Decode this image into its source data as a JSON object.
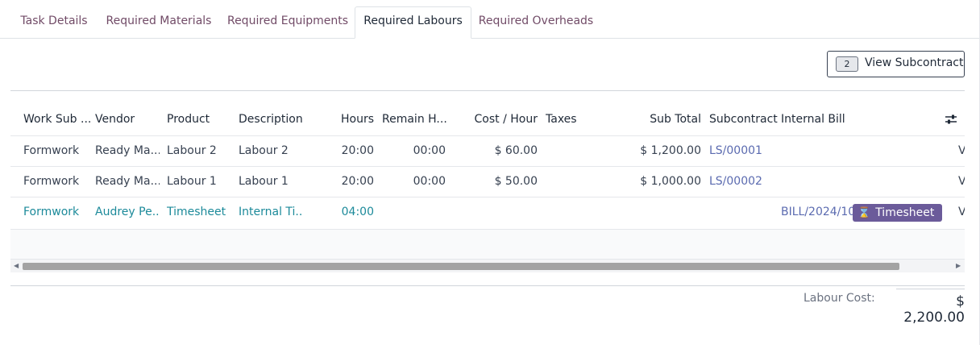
{
  "tabs": [
    {
      "label": "Task Details",
      "active": false
    },
    {
      "label": "Required Materials",
      "active": false
    },
    {
      "label": "Required Equipments",
      "active": false
    },
    {
      "label": "Required Labours",
      "active": true
    },
    {
      "label": "Required Overheads",
      "active": false
    }
  ],
  "subcontract_button": {
    "count": "2",
    "label": "View Subcontract"
  },
  "table": {
    "columns": [
      "Work Sub ...",
      "Vendor",
      "Product",
      "Description",
      "Hours",
      "Remain H...",
      "Cost / Hour",
      "Taxes",
      "Sub Total",
      "Subcontract",
      "Internal Bill"
    ],
    "rows": [
      {
        "work_sub": "Formwork",
        "vendor": "Ready Ma...",
        "product": "Labour 2",
        "description": "Labour 2",
        "hours": "20:00",
        "remain": "00:00",
        "cost_hour": "$ 60.00",
        "taxes": "",
        "sub_total": "$ 1,200.00",
        "subcontract": "LS/00001",
        "internal_bill": "",
        "tail": "V"
      },
      {
        "work_sub": "Formwork",
        "vendor": "Ready Ma...",
        "product": "Labour 1",
        "description": "Labour 1",
        "hours": "20:00",
        "remain": "00:00",
        "cost_hour": "$ 50.00",
        "taxes": "",
        "sub_total": "$ 1,000.00",
        "subcontract": "LS/00002",
        "internal_bill": "",
        "tail": "V"
      },
      {
        "work_sub": "Formwork",
        "vendor": "Audrey Pe...",
        "product": "Timesheet",
        "description": "Internal Ti...",
        "hours": "04:00",
        "remain": "",
        "cost_hour": "",
        "taxes": "",
        "sub_total": "",
        "subcontract": "",
        "internal_bill": "BILL/2024/10",
        "badge": "Timesheet",
        "tail": "V"
      }
    ]
  },
  "totals": {
    "label": "Labour Cost:",
    "value": "$ 2,200.00"
  },
  "icons": {
    "column_settings": "sliders-icon",
    "badge": "hourglass-icon"
  }
}
